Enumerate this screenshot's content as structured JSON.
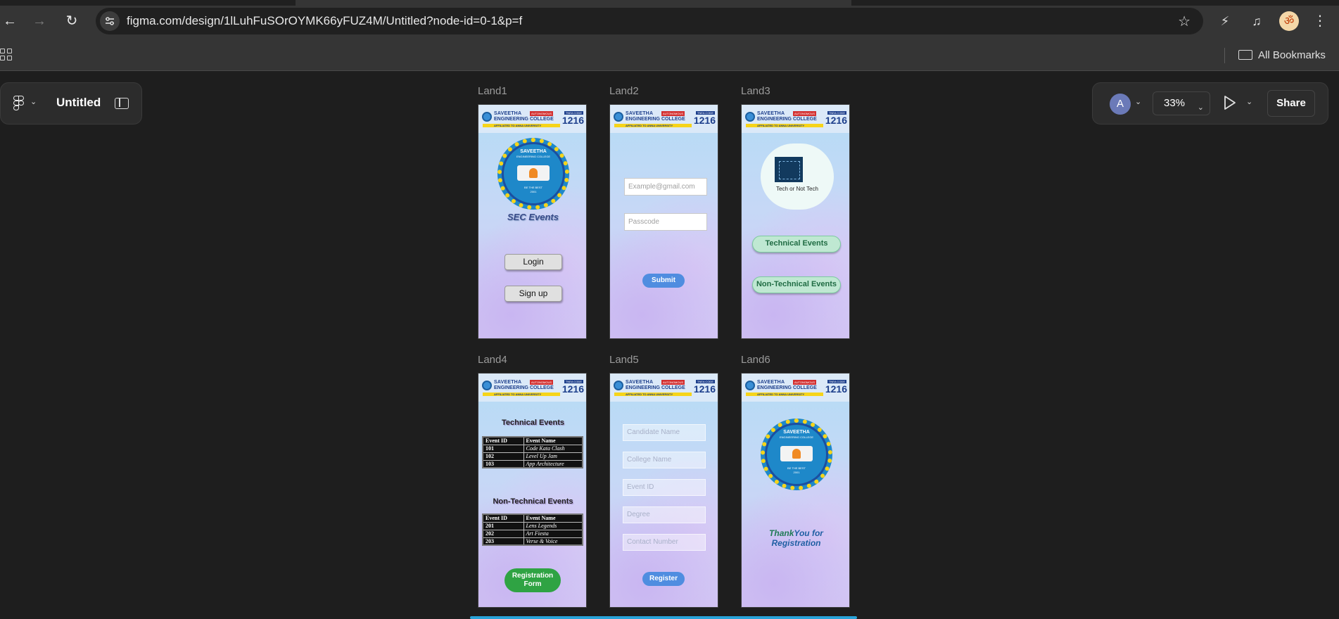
{
  "browser": {
    "url": "figma.com/design/1lLuhFuSOrOYMK66yFUZ4M/Untitled?node-id=0-1&p=f",
    "bookmarks_label": "All Bookmarks",
    "profile_glyph": "ॐ"
  },
  "figma": {
    "file_title": "Untitled",
    "avatar_initial": "A",
    "zoom": "33%",
    "share_label": "Share"
  },
  "college_header": {
    "line1": "SAVEETHA",
    "line2": "ENGINEERING COLLEGE",
    "autonomous": "AUTONOMOUS",
    "affiliation": "AFFILIATED TO ANNA UNIVERSITY",
    "code_label": "TNEA CODE",
    "code": "1216"
  },
  "emblem": {
    "name": "SAVEETHA",
    "subtitle": "ENGINEERING COLLEGE",
    "motto": "BE THE BEST",
    "year": "2001"
  },
  "frames": {
    "land1": {
      "label": "Land1",
      "app_title": "SEC Events",
      "login": "Login",
      "signup": "Sign up"
    },
    "land2": {
      "label": "Land2",
      "email_placeholder": "Example@gmail.com",
      "passcode_placeholder": "Passcode",
      "submit": "Submit"
    },
    "land3": {
      "label": "Land3",
      "logo_caption": "Tech or Not Tech",
      "technical": "Technical Events",
      "non_technical": "Non-Technical Events"
    },
    "land4": {
      "label": "Land4",
      "technical_title": "Technical Events",
      "non_technical_title": "Non-Technical Events",
      "col_id": "Event ID",
      "col_name": "Event Name",
      "technical_rows": [
        {
          "id": "101",
          "name": "Code Kata Clash"
        },
        {
          "id": "102",
          "name": "Level Up Jam"
        },
        {
          "id": "103",
          "name": "App Architecture"
        }
      ],
      "non_technical_rows": [
        {
          "id": "201",
          "name": "Lens Legends"
        },
        {
          "id": "202",
          "name": "Art Fiesta"
        },
        {
          "id": "203",
          "name": "Verse & Voice"
        }
      ],
      "reg_line1": "Registration",
      "reg_line2": "Form"
    },
    "land5": {
      "label": "Land5",
      "fields": [
        "Candidate Name",
        "College Name",
        "Event ID",
        "Degree",
        "Contact Number"
      ],
      "register": "Register"
    },
    "land6": {
      "label": "Land6",
      "thanks_line1a": "Thank",
      "thanks_line1b": "You for",
      "thanks_line2": "Registration"
    }
  }
}
